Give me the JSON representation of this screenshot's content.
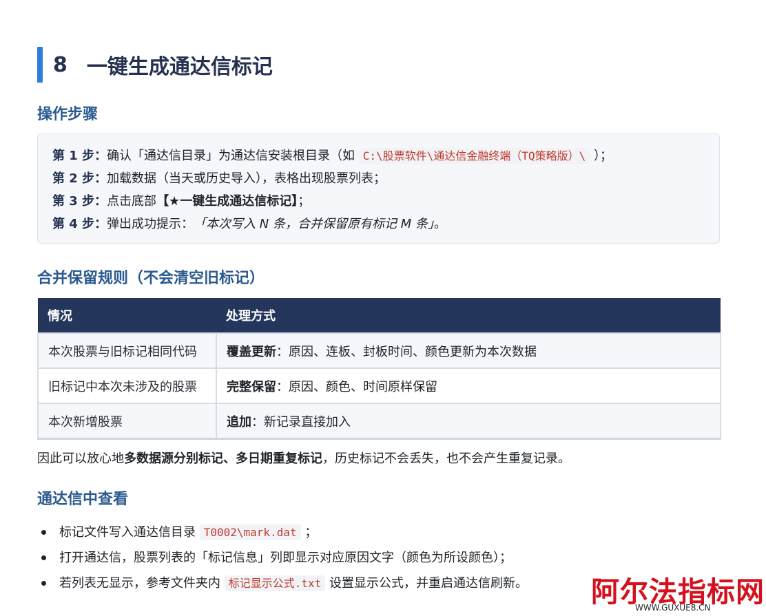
{
  "heading": {
    "number": "8",
    "title": "一键生成通达信标记"
  },
  "section_steps": {
    "title": "操作步骤",
    "steps": [
      {
        "label": "第 1 步：",
        "text_before": "确认「通达信目录」为通达信安装根目录（如 ",
        "code": "C:\\股票软件\\通达信金融终端（TQ策略版）\\",
        "text_after": " ）；"
      },
      {
        "label": "第 2 步：",
        "text": "加载数据（当天或历史导入），表格出现股票列表；"
      },
      {
        "label": "第 3 步：",
        "text_before": "点击底部",
        "bold": "【★一键生成通达信标记】",
        "text_after": "；"
      },
      {
        "label": "第 4 步：",
        "text_before": "弹出成功提示：",
        "italic": "「本次写入 N 条，合并保留原有标记 M 条」",
        "text_after": "。"
      }
    ]
  },
  "section_rules": {
    "title": "合并保留规则（不会清空旧标记）",
    "columns": [
      "情况",
      "处理方式"
    ],
    "rows": [
      {
        "situation": "本次股票与旧标记相同代码",
        "action_bold": "覆盖更新",
        "action_text": "：原因、连板、封板时间、颜色更新为本次数据"
      },
      {
        "situation": "旧标记中本次未涉及的股票",
        "action_bold": "完整保留",
        "action_text": "：原因、颜色、时间原样保留"
      },
      {
        "situation": "本次新增股票",
        "action_bold": "追加",
        "action_text": "：新记录直接加入"
      }
    ],
    "note_before": "因此可以放心地",
    "note_bold": "多数据源分别标记、多日期重复标记",
    "note_after": "，历史标记不会丢失，也不会产生重复记录。"
  },
  "section_view": {
    "title": "通达信中查看",
    "bullets": [
      {
        "before": "标记文件写入通达信目录 ",
        "code": "T0002\\mark.dat",
        "after": " ；"
      },
      {
        "before": "打开通达信，股票列表的「标记信息」列即显示对应原因文字（颜色为所设颜色）；"
      },
      {
        "before": "若列表无显示，参考文件夹内 ",
        "code": "标记显示公式.txt",
        "after": " 设置显示公式，并重启通达信刷新。"
      }
    ]
  },
  "watermark": {
    "brand": "阿尔法指标网",
    "url": "WWW.GUXUE8.CN"
  }
}
